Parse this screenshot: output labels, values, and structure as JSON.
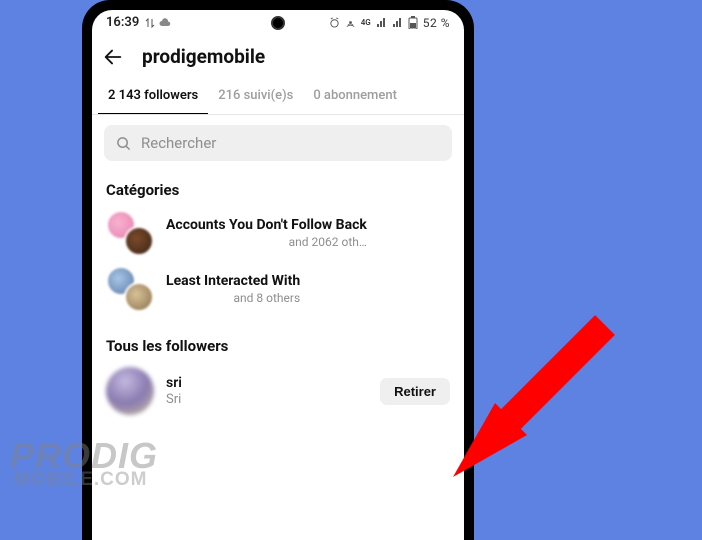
{
  "status": {
    "time": "16:39",
    "network_label": "4G",
    "battery": "52 %"
  },
  "header": {
    "username": "prodigemobile"
  },
  "tabs": {
    "followers": "2 143 followers",
    "following": "216 suivi(e)s",
    "subscriptions": "0 abonnement"
  },
  "search": {
    "placeholder": "Rechercher"
  },
  "categories": {
    "title": "Catégories",
    "items": [
      {
        "label": "Accounts You Don't Follow Back",
        "sub": "and 2062 oth…"
      },
      {
        "label": "Least Interacted With",
        "sub": "and 8 others"
      }
    ]
  },
  "all_followers": {
    "title": "Tous les followers",
    "items": [
      {
        "username": "sri",
        "display_name": "Sri",
        "action": "Retirer"
      }
    ]
  },
  "watermark": {
    "line1": "PRODIG",
    "line2": "MOBILE.COM"
  }
}
